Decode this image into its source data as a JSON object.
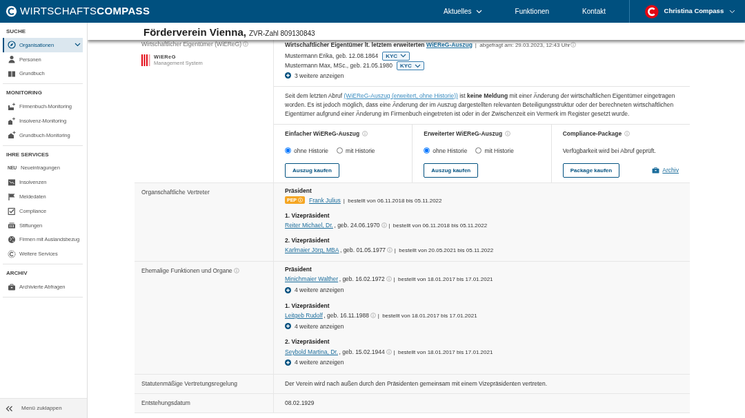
{
  "header": {
    "logo": "WIRTSCHAFTS**COMPASS**",
    "nav": [
      {
        "label": "Aktuelles",
        "kind": "dropdown"
      },
      {
        "label": "Funktionen",
        "kind": "link"
      },
      {
        "label": "Kontakt",
        "kind": "link"
      }
    ],
    "user": "Christina Compass"
  },
  "sidebar": {
    "sections": [
      {
        "title": "SUCHE",
        "items": [
          {
            "label": "Organisationen",
            "selected": true,
            "kind": "dropdown"
          },
          {
            "label": "Personen",
            "selected": false,
            "kind": "link"
          },
          {
            "label": "Grundbuch",
            "selected": false,
            "kind": "link"
          }
        ]
      },
      {
        "title": "MONITORING",
        "items": [
          {
            "label": "Firmenbuch-Monitoring",
            "selected": false,
            "kind": "link"
          },
          {
            "label": "Insolvenz-Monitoring",
            "selected": false,
            "kind": "link"
          },
          {
            "label": "Grundbuch-Monitoring",
            "selected": false,
            "kind": "link"
          }
        ]
      },
      {
        "title": "IHRE SERVICES",
        "items": [
          {
            "label": "Neueintragungen",
            "selected": false,
            "kind": "link",
            "badge": "NEU"
          },
          {
            "label": "Insolvenzen",
            "selected": false,
            "kind": "link"
          },
          {
            "label": "Meldedaten",
            "selected": false,
            "kind": "link"
          },
          {
            "label": "Compliance",
            "selected": false,
            "kind": "link"
          },
          {
            "label": "Stiftungen",
            "selected": false,
            "kind": "link"
          },
          {
            "label": "Firmen mit Auslandsbezug",
            "selected": false,
            "kind": "link"
          },
          {
            "label": "Weitere Services",
            "selected": false,
            "kind": "link"
          }
        ]
      },
      {
        "title": "ARCHIV",
        "items": [
          {
            "label": "Archivierte Abfragen",
            "selected": false,
            "kind": "link"
          }
        ]
      }
    ],
    "collapse": "Menü zuklappen"
  },
  "page": {
    "name": "Förderverein Vienna,",
    "register": "ZVR-Zahl 809130843"
  },
  "wiereg": {
    "label": "Wirtschaftlicher Eigentümer (WiEReG)",
    "logo_title": "WiEReG",
    "logo_subtitle": "Management System",
    "heading": "Wirtschaftlicher Eigentümer lt. letztem erweiterten",
    "heading_link": "WiEReG-Auszug",
    "queried": "|  abgefragt am: 29.03.2023, 12:43 Uhr",
    "owners": [
      {
        "text": "Mustermann Erika, geb. 12.08.1864",
        "badge": "KYC"
      },
      {
        "text": "Mustermann Max, MSc., geb. 21.05.1980",
        "badge": "KYC"
      }
    ],
    "more": "3 weitere anzeigen",
    "notice_start": "Seit dem letzten Abruf",
    "notice_link": "(WiEReG-Auszug (erweitert, ohne Historie))",
    "notice_rest": "ist **keine Meldung** mit einer Änderung der wirtschaftlichen Eigentümer eingetragen worden. Es ist jedoch möglich, dass eine Änderung der im Auszug dargestellten relevanten Beteiligungsstruktur oder der berechneten wirtschaftlichen Eigentümer aufgrund einer Änderung im Firmenbuch eingetreten ist oder in der Zwischenzeit ein Vermerk im Register gesetzt wurde.",
    "products": [
      {
        "title": "Einfacher WiEReG-Auszug",
        "options": [
          {
            "label": "ohne Historie",
            "selected": true
          },
          {
            "label": "mit Historie",
            "selected": false
          }
        ],
        "button": "Auszug kaufen"
      },
      {
        "title": "Erweiterter WiEReG-Auszug",
        "options": [
          {
            "label": "ohne Historie",
            "selected": true
          },
          {
            "label": "mit Historie",
            "selected": false
          }
        ],
        "button": "Auszug kaufen"
      },
      {
        "title": "Compliance-Package",
        "text": "Verfügbarkeit wird bei Abruf geprüft.",
        "button": "Package kaufen",
        "archive": "Archiv"
      }
    ]
  },
  "sections": [
    {
      "label": "Organschaftliche Vertreter",
      "info": false,
      "groups": [
        {
          "role": "Präsident",
          "entries": [
            {
              "pep": "PEP",
              "name": "Frank Julius",
              "period": "|  bestellt von 06.11.2018 bis 05.11.2022"
            }
          ]
        },
        {
          "role": "1. Vizepräsident",
          "entries": [
            {
              "name": "Reiter Michael, Dr.",
              "birth": ", geb. 24.06.1970",
              "period": "|  bestellt von 06.11.2018 bis 05.11.2022"
            }
          ]
        },
        {
          "role": "2. Vizepräsident",
          "entries": [
            {
              "name": "Karlmaier Jörg, MBA",
              "birth": ", geb. 01.05.1977",
              "period": "|  bestellt von 20.05.2021 bis 05.11.2022"
            }
          ]
        }
      ]
    },
    {
      "label": "Ehemalige Funktionen und Organe",
      "info": true,
      "groups": [
        {
          "role": "Präsident",
          "entries": [
            {
              "name": "Minichmaier Walther",
              "birth": ", geb. 16.02.1972",
              "period": "|  bestellt von 18.01.2017 bis 17.01.2021"
            }
          ],
          "more": "4 weitere anzeigen"
        },
        {
          "role": "1. Vizepräsident",
          "entries": [
            {
              "name": "Leitgeb Rudolf",
              "birth": ", geb. 16.11.1988",
              "period": "|  bestellt von 18.01.2017 bis 17.01.2021"
            }
          ],
          "more": "4 weitere anzeigen"
        },
        {
          "role": "2. Vizepräsident",
          "entries": [
            {
              "name": "Seybold Martina, Dr.",
              "birth": ", geb. 15.02.1944",
              "period": "|  bestellt von 18.01.2017 bis 17.01.2021"
            }
          ],
          "more": "4 weitere anzeigen"
        }
      ]
    },
    {
      "label": "Statutenmäßige Vertretungsregelung",
      "info": false,
      "text": "Der Verein wird nach außen durch den Präsidenten gemeinsam mit einem Vizepräsidenten vertreten."
    },
    {
      "label": "Entstehungsdatum",
      "info": false,
      "text": "08.02.1929"
    }
  ]
}
